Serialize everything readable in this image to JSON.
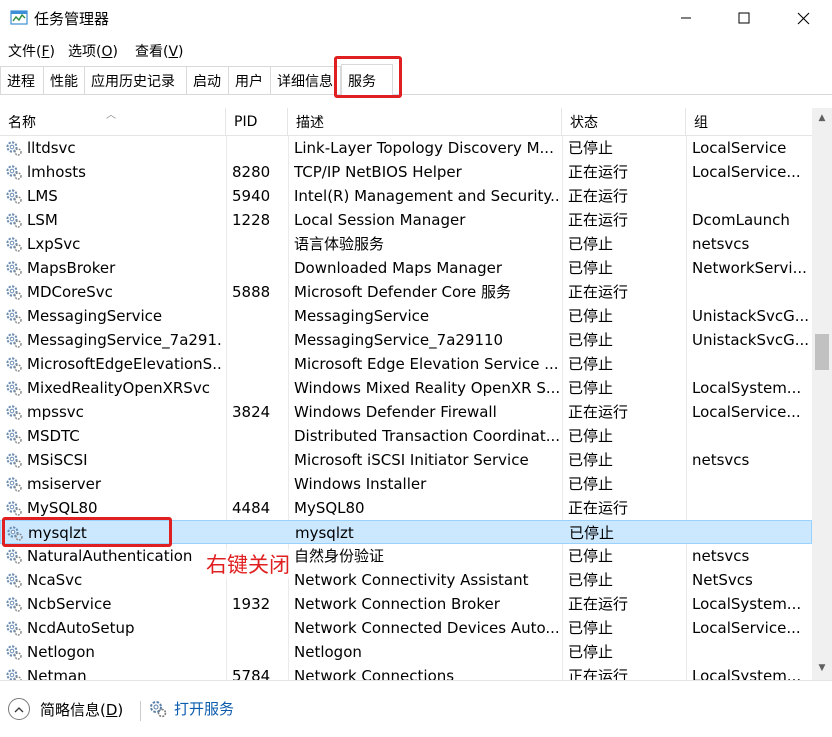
{
  "window": {
    "title": "任务管理器"
  },
  "menu": [
    {
      "label": "文件(",
      "key": "F",
      "suffix": ")"
    },
    {
      "label": "选项(",
      "key": "O",
      "suffix": ")"
    },
    {
      "label": "查看(",
      "key": "V",
      "suffix": ")"
    }
  ],
  "tabs": [
    "进程",
    "性能",
    "应用历史记录",
    "启动",
    "用户",
    "详细信息",
    "服务"
  ],
  "active_tab": "服务",
  "columns": {
    "name": "名称",
    "pid": "PID",
    "description": "描述",
    "status": "状态",
    "group": "组"
  },
  "services": [
    {
      "name": "lltdsvc",
      "pid": "",
      "description": "Link-Layer Topology Discovery M...",
      "status": "已停止",
      "group": "LocalService"
    },
    {
      "name": "lmhosts",
      "pid": "8280",
      "description": "TCP/IP NetBIOS Helper",
      "status": "正在运行",
      "group": "LocalService..."
    },
    {
      "name": "LMS",
      "pid": "5940",
      "description": "Intel(R) Management and Security...",
      "status": "正在运行",
      "group": ""
    },
    {
      "name": "LSM",
      "pid": "1228",
      "description": "Local Session Manager",
      "status": "正在运行",
      "group": "DcomLaunch"
    },
    {
      "name": "LxpSvc",
      "pid": "",
      "description": "语言体验服务",
      "status": "已停止",
      "group": "netsvcs"
    },
    {
      "name": "MapsBroker",
      "pid": "",
      "description": "Downloaded Maps Manager",
      "status": "已停止",
      "group": "NetworkServi..."
    },
    {
      "name": "MDCoreSvc",
      "pid": "5888",
      "description": "Microsoft Defender Core 服务",
      "status": "正在运行",
      "group": ""
    },
    {
      "name": "MessagingService",
      "pid": "",
      "description": "MessagingService",
      "status": "已停止",
      "group": "UnistackSvcG..."
    },
    {
      "name": "MessagingService_7a291...",
      "pid": "",
      "description": "MessagingService_7a29110",
      "status": "已停止",
      "group": "UnistackSvcG..."
    },
    {
      "name": "MicrosoftEdgeElevationS...",
      "pid": "",
      "description": "Microsoft Edge Elevation Service ...",
      "status": "已停止",
      "group": ""
    },
    {
      "name": "MixedRealityOpenXRSvc",
      "pid": "",
      "description": "Windows Mixed Reality OpenXR S...",
      "status": "已停止",
      "group": "LocalSystem..."
    },
    {
      "name": "mpssvc",
      "pid": "3824",
      "description": "Windows Defender Firewall",
      "status": "正在运行",
      "group": "LocalService..."
    },
    {
      "name": "MSDTC",
      "pid": "",
      "description": "Distributed Transaction Coordinat...",
      "status": "已停止",
      "group": ""
    },
    {
      "name": "MSiSCSI",
      "pid": "",
      "description": "Microsoft iSCSI Initiator Service",
      "status": "已停止",
      "group": "netsvcs"
    },
    {
      "name": "msiserver",
      "pid": "",
      "description": "Windows Installer",
      "status": "已停止",
      "group": ""
    },
    {
      "name": "MySQL80",
      "pid": "4484",
      "description": "MySQL80",
      "status": "正在运行",
      "group": ""
    },
    {
      "name": "mysqlzt",
      "pid": "",
      "description": "mysqlzt",
      "status": "已停止",
      "group": "",
      "selected": true
    },
    {
      "name": "NaturalAuthentication",
      "pid": "",
      "description": "自然身份验证",
      "status": "已停止",
      "group": "netsvcs"
    },
    {
      "name": "NcaSvc",
      "pid": "",
      "description": "Network Connectivity Assistant",
      "status": "已停止",
      "group": "NetSvcs"
    },
    {
      "name": "NcbService",
      "pid": "1932",
      "description": "Network Connection Broker",
      "status": "正在运行",
      "group": "LocalSystem..."
    },
    {
      "name": "NcdAutoSetup",
      "pid": "",
      "description": "Network Connected Devices Auto...",
      "status": "已停止",
      "group": "LocalService..."
    },
    {
      "name": "Netlogon",
      "pid": "",
      "description": "Netlogon",
      "status": "已停止",
      "group": ""
    },
    {
      "name": "Netman",
      "pid": "5784",
      "description": "Network Connections",
      "status": "正在运行",
      "group": "LocalSystem..."
    }
  ],
  "annotation": "右键关闭",
  "footer": {
    "fewer_details": "简略信息(",
    "fewer_details_key": "D",
    "fewer_details_suffix": ")",
    "open_services": "打开服务"
  },
  "colors": {
    "highlight_red": "#e02020",
    "selected_row": "#cce8ff",
    "link_blue": "#0b5cad"
  }
}
